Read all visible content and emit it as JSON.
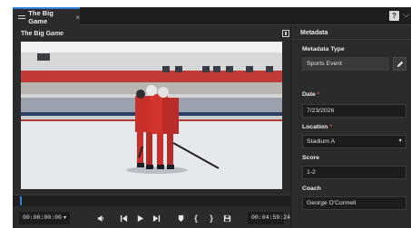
{
  "tab": {
    "label": "The Big Game",
    "close": "×"
  },
  "window": {
    "help": "?",
    "menu": "⌵"
  },
  "player": {
    "title": "The Big Game",
    "start_time": "00:00:00:00",
    "end_time": "00:04:59:24",
    "playback_progress": 0.0
  },
  "metadata": {
    "header": "Metadata",
    "type_label": "Metadata Type",
    "type_value": "Sports Event",
    "date_label": "Date",
    "date_value": "7/23/2026",
    "location_label": "Location",
    "location_value": "Stadium A",
    "score_label": "Score",
    "score_value": "1-2",
    "coach_label": "Coach",
    "coach_value": "George O'Connell",
    "required_mark": "*"
  },
  "colors": {
    "accent": "#2f7ed8",
    "required": "#e24b4b",
    "panel": "#2b2b2b",
    "field": "#1c1c1c"
  }
}
